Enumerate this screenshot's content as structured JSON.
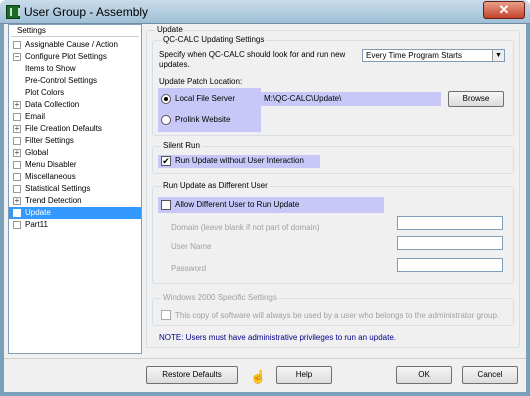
{
  "window": {
    "title": "User Group - Assembly",
    "close_label": "✕"
  },
  "tree": {
    "header": "Settings",
    "items": [
      {
        "label": "Assignable Cause / Action",
        "level": 0,
        "exp": ""
      },
      {
        "label": "Configure Plot Settings",
        "level": 0,
        "exp": "−"
      },
      {
        "label": "Items to Show",
        "level": 1,
        "exp": ""
      },
      {
        "label": "Pre-Control Settings",
        "level": 1,
        "exp": ""
      },
      {
        "label": "Plot Colors",
        "level": 1,
        "exp": ""
      },
      {
        "label": "Data Collection",
        "level": 0,
        "exp": "+"
      },
      {
        "label": "Email",
        "level": 0,
        "exp": ""
      },
      {
        "label": "File Creation Defaults",
        "level": 0,
        "exp": "+"
      },
      {
        "label": "Filter Settings",
        "level": 0,
        "exp": ""
      },
      {
        "label": "Global",
        "level": 0,
        "exp": "+"
      },
      {
        "label": "Menu Disabler",
        "level": 0,
        "exp": ""
      },
      {
        "label": "Miscellaneous",
        "level": 0,
        "exp": ""
      },
      {
        "label": "Statistical Settings",
        "level": 0,
        "exp": ""
      },
      {
        "label": "Trend Detection",
        "level": 0,
        "exp": "+"
      },
      {
        "label": "Update",
        "level": 0,
        "exp": "",
        "selected": true
      },
      {
        "label": "Part11",
        "level": 0,
        "exp": ""
      }
    ]
  },
  "update": {
    "title": "Update",
    "qc": {
      "title": "QC-CALC Updating Settings",
      "specify_label": "Specify when QC-CALC should look for and run new updates.",
      "when_value": "Every Time Program Starts",
      "patch_label": "Update Patch Location:",
      "local_label": "Local File Server",
      "prolink_label": "Prolink Website",
      "path_value": "M:\\QC-CALC\\Update\\",
      "browse_label": "Browse"
    },
    "silent": {
      "title": "Silent Run",
      "checkbox_label": "Run Update without User Interaction",
      "checked_mark": "✔"
    },
    "different": {
      "title": "Run Update as Different User",
      "allow_label": "Allow Different User to Run Update",
      "domain_label": "Domain (leave blank if not part of domain)",
      "username_label": "User Name",
      "password_label": "Password"
    },
    "win2000": {
      "title": "Windows 2000 Specific Settings",
      "checkbox_label": "This copy of software will always be used by a user who belongs to the administrator group."
    },
    "note": "NOTE: Users must have administrative privileges to run an update."
  },
  "buttons": {
    "restore": "Restore Defaults",
    "help": "Help",
    "ok": "OK",
    "cancel": "Cancel"
  }
}
